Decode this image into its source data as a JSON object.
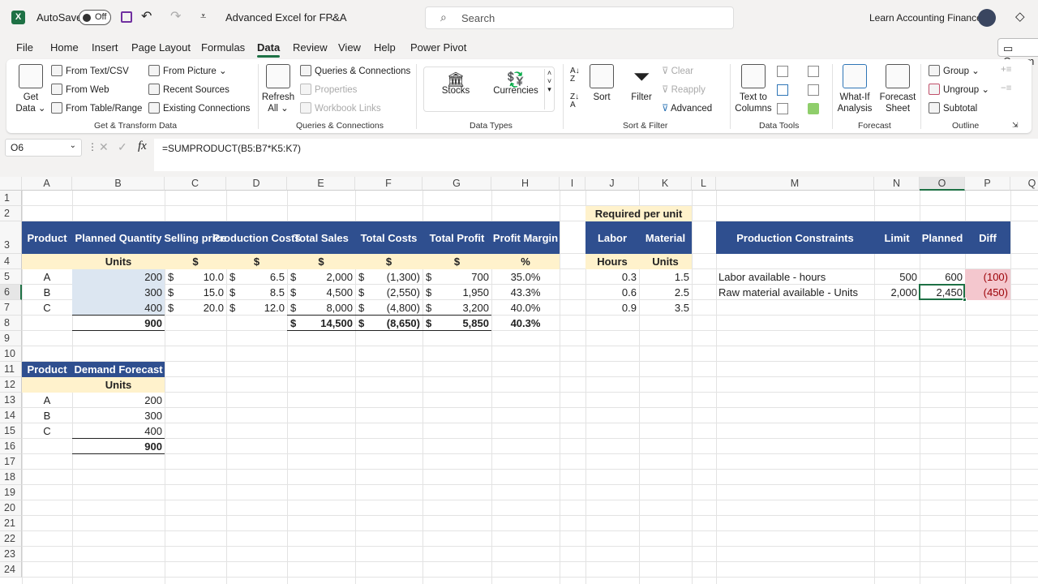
{
  "titlebar": {
    "autosave_label": "AutoSave",
    "autosave_state": "Off",
    "doc_title": "Advanced Excel for FP&A",
    "search_placeholder": "Search",
    "account": "Learn Accounting Finance"
  },
  "tabs": [
    "File",
    "Home",
    "Insert",
    "Page Layout",
    "Formulas",
    "Data",
    "Review",
    "View",
    "Help",
    "Power Pivot"
  ],
  "active_tab": "Data",
  "comments_button": "Comm",
  "ribbon": {
    "get_data": "Get Data",
    "get_transform": [
      "From Text/CSV",
      "From Web",
      "From Table/Range",
      "From Picture",
      "Recent Sources",
      "Existing Connections"
    ],
    "group_get": "Get & Transform Data",
    "refresh_all": "Refresh All",
    "queries": [
      "Queries & Connections",
      "Properties",
      "Workbook Links"
    ],
    "group_queries": "Queries & Connections",
    "stocks": "Stocks",
    "currencies": "Currencies",
    "group_types": "Data Types",
    "sort": "Sort",
    "filter": "Filter",
    "clear": "Clear",
    "reapply": "Reapply",
    "advanced": "Advanced",
    "group_sort": "Sort & Filter",
    "text_to_columns": "Text to Columns",
    "group_tools": "Data Tools",
    "what_if": "What-If Analysis",
    "forecast_sheet": "Forecast Sheet",
    "group_forecast": "Forecast",
    "group_btn": "Group",
    "ungroup_btn": "Ungroup",
    "subtotal": "Subtotal",
    "group_outline": "Outline"
  },
  "formula_bar": {
    "name_box": "O6",
    "formula": "=SUMPRODUCT(B5:B7*K5:K7)"
  },
  "columns": [
    "A",
    "B",
    "C",
    "D",
    "E",
    "F",
    "G",
    "H",
    "I",
    "J",
    "K",
    "L",
    "M",
    "N",
    "O",
    "P",
    "Q"
  ],
  "rows": [
    "1",
    "2",
    "3",
    "4",
    "5",
    "6",
    "7",
    "8",
    "9",
    "10",
    "11",
    "12",
    "13",
    "14",
    "15",
    "16",
    "17",
    "18",
    "19",
    "20",
    "21",
    "22",
    "23",
    "24"
  ],
  "selected_cell": "O6",
  "colors": {
    "header": "#2f4f8f",
    "subheader": "#fff2cc",
    "input": "#dce6f1",
    "bad_fill": "#f4c7ce",
    "bad_text": "#9c0006",
    "accent": "#1e7145"
  },
  "cells": [
    {
      "ref": "A3",
      "text": "Product",
      "s": "hdr c"
    },
    {
      "ref": "B3",
      "text": "Planned Quantity",
      "s": "hdr c"
    },
    {
      "ref": "C3",
      "text": "Selling price",
      "s": "hdr c"
    },
    {
      "ref": "D3",
      "text": "Production Costs",
      "s": "hdr c"
    },
    {
      "ref": "E3",
      "text": "Total Sales",
      "s": "hdr c"
    },
    {
      "ref": "F3",
      "text": "Total Costs",
      "s": "hdr c"
    },
    {
      "ref": "G3",
      "text": "Total Profit",
      "s": "hdr c"
    },
    {
      "ref": "H3",
      "text": "Profit Margin",
      "s": "hdr c"
    },
    {
      "ref": "B4",
      "text": "Units",
      "s": "b c"
    },
    {
      "ref": "C4",
      "text": "$",
      "s": "b c"
    },
    {
      "ref": "D4",
      "text": "$",
      "s": "b c"
    },
    {
      "ref": "E4",
      "text": "$",
      "s": "b c"
    },
    {
      "ref": "F4",
      "text": "$",
      "s": "b c"
    },
    {
      "ref": "G4",
      "text": "$",
      "s": "b c"
    },
    {
      "ref": "H4",
      "text": "%",
      "s": "b c"
    },
    {
      "ref": "A5",
      "text": "A",
      "s": "c"
    },
    {
      "ref": "B5",
      "text": "200",
      "s": "r"
    },
    {
      "ref": "C5",
      "text": "10.0",
      "s": "r",
      "cur": "$"
    },
    {
      "ref": "D5",
      "text": "6.5",
      "s": "r",
      "cur": "$"
    },
    {
      "ref": "E5",
      "text": "2,000",
      "s": "r",
      "cur": "$"
    },
    {
      "ref": "F5",
      "text": "(1,300)",
      "s": "r",
      "cur": "$"
    },
    {
      "ref": "G5",
      "text": "700",
      "s": "r",
      "cur": "$"
    },
    {
      "ref": "H5",
      "text": "35.0%",
      "s": "c"
    },
    {
      "ref": "A6",
      "text": "B",
      "s": "c"
    },
    {
      "ref": "B6",
      "text": "300",
      "s": "r"
    },
    {
      "ref": "C6",
      "text": "15.0",
      "s": "r",
      "cur": "$"
    },
    {
      "ref": "D6",
      "text": "8.5",
      "s": "r",
      "cur": "$"
    },
    {
      "ref": "E6",
      "text": "4,500",
      "s": "r",
      "cur": "$"
    },
    {
      "ref": "F6",
      "text": "(2,550)",
      "s": "r",
      "cur": "$"
    },
    {
      "ref": "G6",
      "text": "1,950",
      "s": "r",
      "cur": "$"
    },
    {
      "ref": "H6",
      "text": "43.3%",
      "s": "c"
    },
    {
      "ref": "A7",
      "text": "C",
      "s": "c"
    },
    {
      "ref": "B7",
      "text": "400",
      "s": "r"
    },
    {
      "ref": "C7",
      "text": "20.0",
      "s": "r",
      "cur": "$"
    },
    {
      "ref": "D7",
      "text": "12.0",
      "s": "r",
      "cur": "$"
    },
    {
      "ref": "E7",
      "text": "8,000",
      "s": "r",
      "cur": "$"
    },
    {
      "ref": "F7",
      "text": "(4,800)",
      "s": "r",
      "cur": "$"
    },
    {
      "ref": "G7",
      "text": "3,200",
      "s": "r",
      "cur": "$"
    },
    {
      "ref": "H7",
      "text": "40.0%",
      "s": "c"
    },
    {
      "ref": "B8",
      "text": "900",
      "s": "r b"
    },
    {
      "ref": "E8",
      "text": "14,500",
      "s": "r b",
      "cur": "$"
    },
    {
      "ref": "F8",
      "text": "(8,650)",
      "s": "r b",
      "cur": "$"
    },
    {
      "ref": "G8",
      "text": "5,850",
      "s": "r b",
      "cur": "$"
    },
    {
      "ref": "H8",
      "text": "40.3%",
      "s": "c b"
    },
    {
      "ref": "J2",
      "text": "Required per unit",
      "s": "b c",
      "span": 2
    },
    {
      "ref": "J3",
      "text": "Labor",
      "s": "hdr c"
    },
    {
      "ref": "K3",
      "text": "Material",
      "s": "hdr c"
    },
    {
      "ref": "J4",
      "text": "Hours",
      "s": "b c"
    },
    {
      "ref": "K4",
      "text": "Units",
      "s": "b c"
    },
    {
      "ref": "J5",
      "text": "0.3",
      "s": "r"
    },
    {
      "ref": "K5",
      "text": "1.5",
      "s": "r"
    },
    {
      "ref": "J6",
      "text": "0.6",
      "s": "r"
    },
    {
      "ref": "K6",
      "text": "2.5",
      "s": "r"
    },
    {
      "ref": "J7",
      "text": "0.9",
      "s": "r"
    },
    {
      "ref": "K7",
      "text": "3.5",
      "s": "r"
    },
    {
      "ref": "M3",
      "text": "Production Constraints",
      "s": "hdr c"
    },
    {
      "ref": "N3",
      "text": "Limit",
      "s": "hdr c"
    },
    {
      "ref": "O3",
      "text": "Planned",
      "s": "hdr c"
    },
    {
      "ref": "P3",
      "text": "Diff",
      "s": "hdr c"
    },
    {
      "ref": "M5",
      "text": "Labor available - hours",
      "s": "l"
    },
    {
      "ref": "N5",
      "text": "500",
      "s": "r"
    },
    {
      "ref": "O5",
      "text": "600",
      "s": "r"
    },
    {
      "ref": "P5",
      "text": "(100)",
      "s": "r bad"
    },
    {
      "ref": "M6",
      "text": "Raw material available - Units",
      "s": "l"
    },
    {
      "ref": "N6",
      "text": "2,000",
      "s": "r"
    },
    {
      "ref": "O6",
      "text": "2,450",
      "s": "r"
    },
    {
      "ref": "P6",
      "text": "(450)",
      "s": "r bad"
    },
    {
      "ref": "A11",
      "text": "Product",
      "s": "hdr c"
    },
    {
      "ref": "B11",
      "text": "Demand Forecast",
      "s": "hdr c"
    },
    {
      "ref": "B12",
      "text": "Units",
      "s": "b c"
    },
    {
      "ref": "A13",
      "text": "A",
      "s": "c"
    },
    {
      "ref": "B13",
      "text": "200",
      "s": "r"
    },
    {
      "ref": "A14",
      "text": "B",
      "s": "c"
    },
    {
      "ref": "B14",
      "text": "300",
      "s": "r"
    },
    {
      "ref": "A15",
      "text": "C",
      "s": "c"
    },
    {
      "ref": "B15",
      "text": "400",
      "s": "r"
    },
    {
      "ref": "B16",
      "text": "900",
      "s": "r b"
    }
  ]
}
